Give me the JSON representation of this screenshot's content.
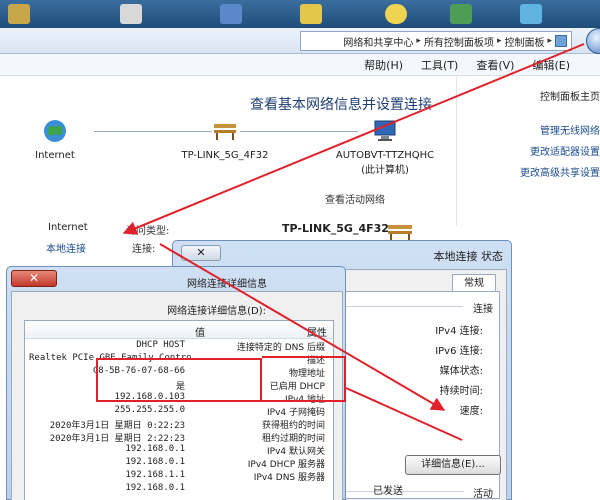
{
  "address": {
    "crumbs": [
      "控制面板",
      "所有控制面板项",
      "网络和共享中心"
    ],
    "separator": "▸"
  },
  "menu": [
    "编辑(E)",
    "查看(V)",
    "工具(T)",
    "帮助(H)"
  ],
  "main": {
    "title": "查看基本网络信息并设置连接",
    "nodes": [
      {
        "label": "Internet",
        "sublabel": ""
      },
      {
        "label": "TP-LINK_5G_4F32",
        "sublabel": ""
      },
      {
        "label": "AUTOBVT-TTZHQHC",
        "sublabel": "(此计算机)"
      }
    ],
    "active_networks_label": "查看活动网络",
    "network_name": "TP-LINK_5G_4F32",
    "access_type_label": "访问类型:",
    "access_type_value": "Internet",
    "connection_label": "连接:",
    "connection_value": "本地连接"
  },
  "sidebar": {
    "items": [
      "控制面板主页",
      "管理无线网络",
      "更改适配器设置",
      "更改高级共享设置"
    ]
  },
  "status_dialog": {
    "title": "本地连接 状态",
    "tab": "常规",
    "section": "连接",
    "rows": [
      "IPv4 连接:",
      "IPv6 连接:",
      "媒体状态:",
      "持续时间:",
      "速度:"
    ],
    "details_button": "详细信息(E)...",
    "activity_label": "活动",
    "sent_label": "已发送"
  },
  "details_dialog": {
    "title": "网络连接详细信息",
    "close": "✕",
    "caption": "网络连接详细信息(D):",
    "col_property": "属性",
    "col_value": "值",
    "rows": [
      {
        "property": "连接特定的 DNS 后缀",
        "value": "DHCP HOST"
      },
      {
        "property": "描述",
        "value": "Realtek PCIe GBE Family Contro"
      },
      {
        "property": "物理地址",
        "value": "C8-5B-76-07-68-66"
      },
      {
        "property": "已启用 DHCP",
        "value": "是"
      },
      {
        "property": "IPv4 地址",
        "value": "192.168.0.103"
      },
      {
        "property": "IPv4 子网掩码",
        "value": "255.255.255.0"
      },
      {
        "property": "获得租约的时间",
        "value": "2020年3月1日 星期日 0:22:23"
      },
      {
        "property": "租约过期的时间",
        "value": "2020年3月1日 星期日 2:22:23"
      },
      {
        "property": "IPv4 默认网关",
        "value": "192.168.0.1"
      },
      {
        "property": "IPv4 DHCP 服务器",
        "value": "192.168.0.1"
      },
      {
        "property": "IPv4 DNS 服务器",
        "value": "192.168.1.1"
      },
      {
        "property": "",
        "value": "192.168.0.1"
      }
    ]
  },
  "colors": {
    "highlight": "#e0202a",
    "link": "#1a4c8f",
    "title": "#1f3f73"
  }
}
